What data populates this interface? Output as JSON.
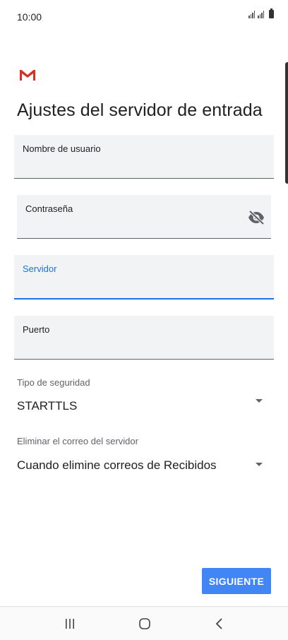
{
  "status_bar": {
    "time": "10:00"
  },
  "title": "Ajustes del servidor de entrada",
  "fields": {
    "username": {
      "label": "Nombre de usuario",
      "value": ""
    },
    "password": {
      "label": "Contraseña",
      "value": ""
    },
    "server": {
      "label": "Servidor",
      "value": ""
    },
    "port": {
      "label": "Puerto",
      "value": ""
    }
  },
  "security": {
    "label": "Tipo de seguridad",
    "value": "STARTTLS"
  },
  "delete_mail": {
    "label": "Eliminar el correo del servidor",
    "value": "Cuando elimine correos de Recibidos"
  },
  "next_button": {
    "label": "SIGUIENTE"
  },
  "colors": {
    "accent": "#1a73e8",
    "button": "#4285f4",
    "gmail_red": "#d93025"
  }
}
